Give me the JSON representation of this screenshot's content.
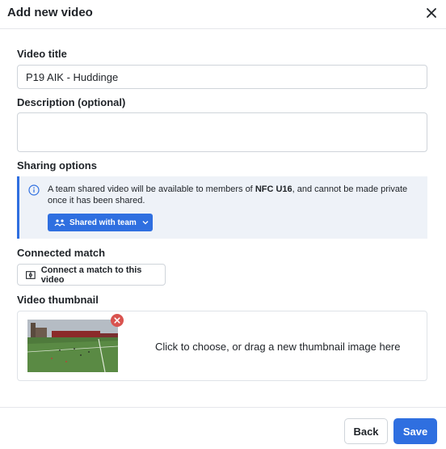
{
  "dialog": {
    "title": "Add new video"
  },
  "video_title": {
    "label": "Video title",
    "value": "P19 AIK - Huddinge"
  },
  "description": {
    "label": "Description (optional)",
    "value": ""
  },
  "sharing": {
    "label": "Sharing options",
    "info_prefix": "A team shared video will be available to members of ",
    "team_name": "NFC U16",
    "info_suffix": ", and cannot be made private once it has been shared.",
    "button_label": "Shared with team"
  },
  "connected_match": {
    "label": "Connected match",
    "button_label": "Connect a match to this video"
  },
  "thumbnail": {
    "label": "Video thumbnail",
    "hint": "Click to choose, or drag a new thumbnail image here"
  },
  "footer": {
    "back_label": "Back",
    "save_label": "Save"
  },
  "colors": {
    "primary": "#2f6fe0",
    "info_bg": "#eef2f8",
    "remove": "#d9534f"
  },
  "icons": [
    "close-icon",
    "info-icon",
    "team-icon",
    "chevron-down-icon",
    "match-icon",
    "remove-icon"
  ]
}
